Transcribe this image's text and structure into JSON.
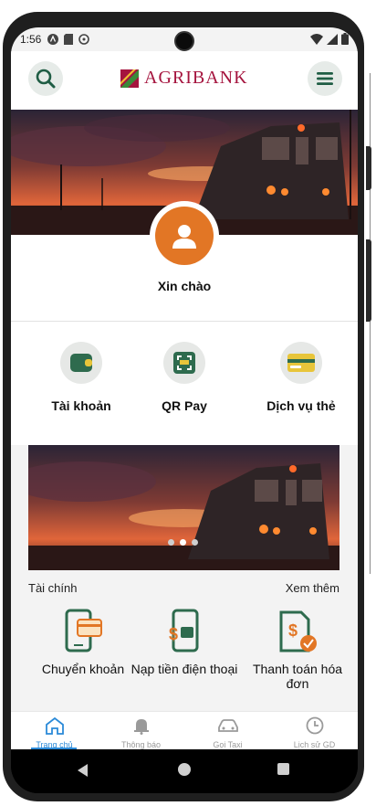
{
  "status_bar": {
    "time": "1:56"
  },
  "app_bar": {
    "brand": "AGRIBANK",
    "brand_color": "#a5143e",
    "search_icon": "search-icon",
    "menu_icon": "menu-icon"
  },
  "profile": {
    "greeting": "Xin chào",
    "avatar_color": "#e27625"
  },
  "quick_actions": [
    {
      "label": "Tài khoản",
      "icon": "wallet-icon"
    },
    {
      "label": "QR Pay",
      "icon": "qr-scan-icon"
    },
    {
      "label": "Dịch vụ thẻ",
      "icon": "card-icon"
    }
  ],
  "banner": {
    "slide_count": 3,
    "active_slide": 1
  },
  "finance": {
    "title": "Tài chính",
    "more": "Xem thêm",
    "items": [
      {
        "label": "Chuyển khoản",
        "icon": "transfer-phone-icon"
      },
      {
        "label": "Nạp tiền điện thoại",
        "icon": "topup-phone-icon"
      },
      {
        "label": "Thanh toán hóa đơn",
        "icon": "bill-payment-icon"
      }
    ]
  },
  "bottom_nav": [
    {
      "label": "Trang chủ",
      "icon": "home-icon",
      "active": true
    },
    {
      "label": "Thông báo",
      "icon": "bell-icon",
      "active": false
    },
    {
      "label": "Gọi Taxi",
      "icon": "car-icon",
      "active": false
    },
    {
      "label": "Lịch sử GD",
      "icon": "clock-icon",
      "active": false
    }
  ],
  "colors": {
    "accent_green": "#2e6b4e",
    "accent_orange": "#e27625",
    "nav_active": "#2b8ad8"
  }
}
